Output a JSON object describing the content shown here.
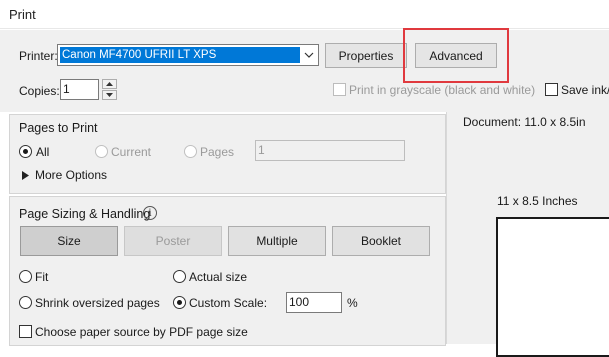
{
  "window": {
    "title": "Print"
  },
  "printer": {
    "label": "Printer:",
    "selected": "Canon MF4700 UFRII LT XPS",
    "properties_label": "Properties",
    "advanced_label": "Advanced"
  },
  "copies": {
    "label": "Copies:",
    "value": "1"
  },
  "options": {
    "grayscale_label": "Print in grayscale (black and white)",
    "save_ink_label": "Save ink/t"
  },
  "pages_to_print": {
    "title": "Pages to Print",
    "all_label": "All",
    "current_label": "Current",
    "pages_label": "Pages",
    "pages_value": "1",
    "more_options_label": "More Options"
  },
  "sizing": {
    "title": "Page Sizing & Handling",
    "buttons": [
      "Size",
      "Poster",
      "Multiple",
      "Booklet"
    ],
    "fit_label": "Fit",
    "actual_size_label": "Actual size",
    "shrink_label": "Shrink oversized pages",
    "custom_scale_label": "Custom Scale:",
    "custom_scale_value": "100",
    "percent_label": "%",
    "paper_source_label": "Choose paper source by PDF page size"
  },
  "preview": {
    "document_label": "Document: 11.0 x 8.5in",
    "paper_label": "11 x 8.5 Inches"
  },
  "colors": {
    "selection": "#0078d7",
    "highlight": "#e0393e"
  },
  "icons": [
    "chevron-down-icon",
    "spin-up-icon",
    "spin-down-icon",
    "triangle-right-icon",
    "info-icon"
  ]
}
